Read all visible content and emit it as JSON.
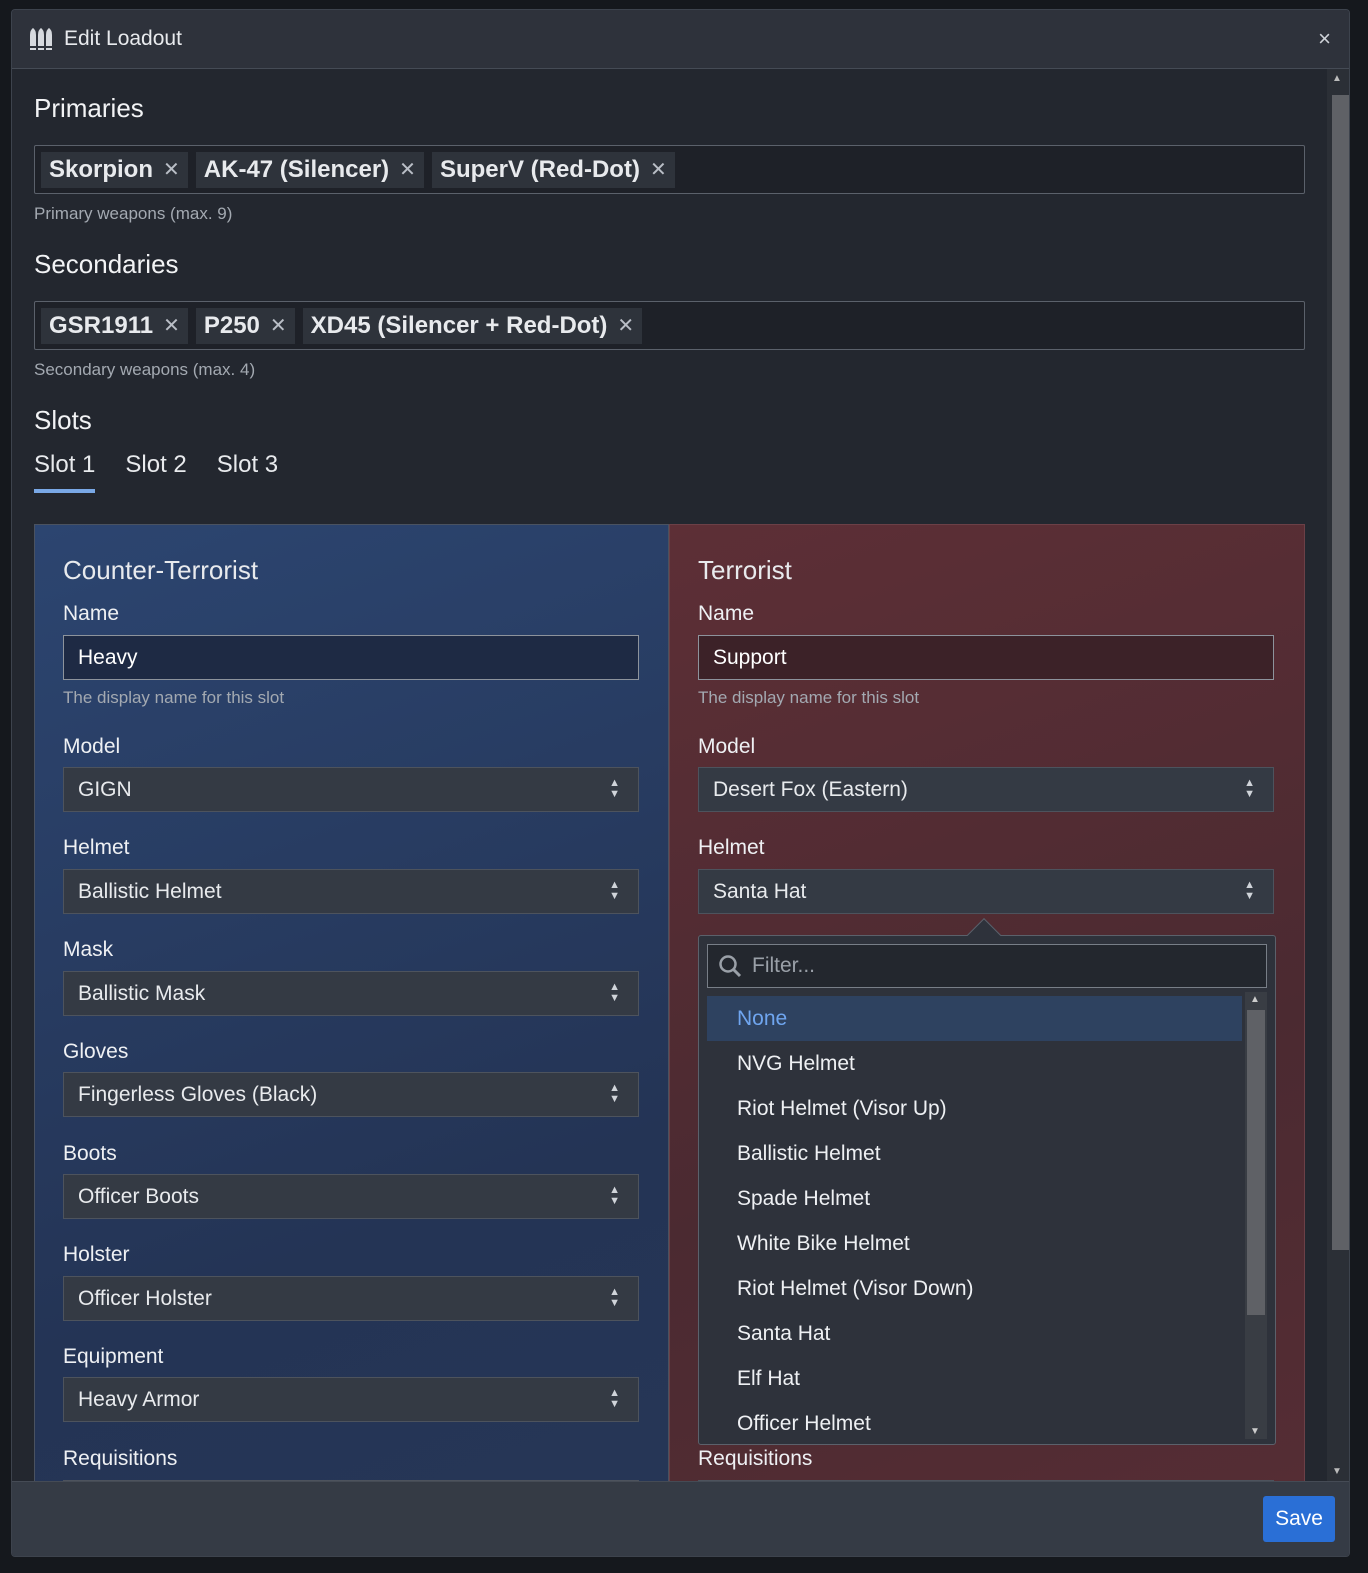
{
  "modal": {
    "title": "Edit Loadout",
    "icon": "ammo-icon",
    "close": "×",
    "save_label": "Save"
  },
  "primaries": {
    "heading": "Primaries",
    "tags": [
      "Skorpion",
      "AK-47 (Silencer)",
      "SuperV (Red-Dot)"
    ],
    "help": "Primary weapons (max. 9)"
  },
  "secondaries": {
    "heading": "Secondaries",
    "tags": [
      "GSR1911",
      "P250",
      "XD45 (Silencer + Red-Dot)"
    ],
    "help": "Secondary weapons (max. 4)"
  },
  "slots": {
    "heading": "Slots",
    "tabs": [
      "Slot 1",
      "Slot 2",
      "Slot 3"
    ],
    "active": "Slot 1"
  },
  "labels": {
    "name": "Name",
    "name_hint": "The display name for this slot",
    "model": "Model",
    "helmet": "Helmet",
    "mask": "Mask",
    "gloves": "Gloves",
    "boots": "Boots",
    "holster": "Holster",
    "equipment": "Equipment",
    "requisitions": "Requisitions"
  },
  "ct": {
    "title": "Counter-Terrorist",
    "name": "Heavy",
    "model": "GIGN",
    "helmet": "Ballistic Helmet",
    "mask": "Ballistic Mask",
    "gloves": "Fingerless Gloves (Black)",
    "boots": "Officer Boots",
    "holster": "Officer Holster",
    "equipment": "Heavy Armor",
    "color": "#2c4570"
  },
  "t": {
    "title": "Terrorist",
    "name": "Support",
    "model": "Desert Fox (Eastern)",
    "helmet": "Santa Hat",
    "color": "#5d2f36"
  },
  "dropdown": {
    "filter_placeholder": "Filter...",
    "highlighted": "None",
    "options": [
      "None",
      "NVG Helmet",
      "Riot Helmet (Visor Up)",
      "Ballistic Helmet",
      "Spade Helmet",
      "White Bike Helmet",
      "Riot Helmet (Visor Down)",
      "Santa Hat",
      "Elf Hat",
      "Officer Helmet"
    ]
  }
}
